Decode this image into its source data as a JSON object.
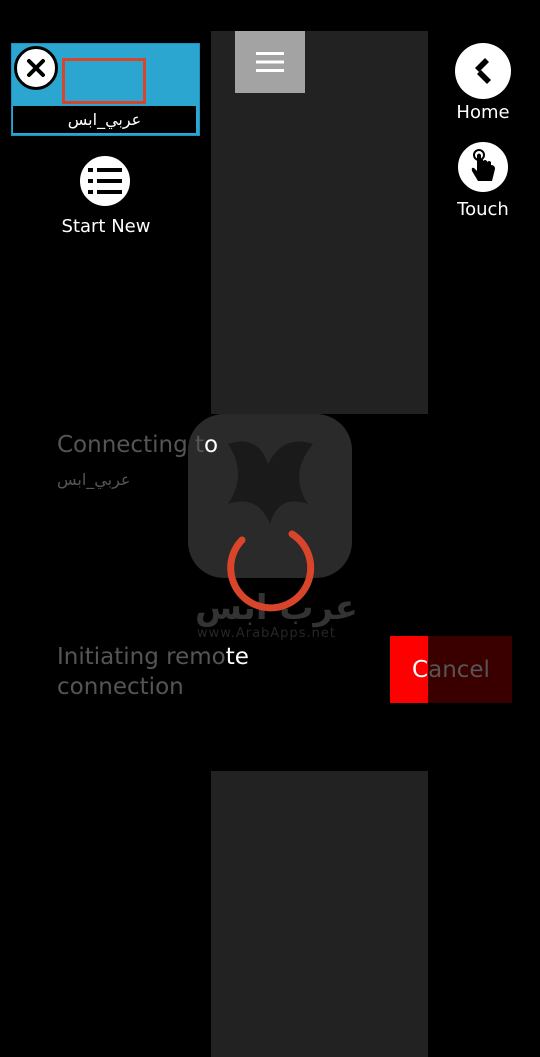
{
  "session": {
    "name": "عربي_ابس"
  },
  "toolbar": {
    "start_new_label": "Start New",
    "home_label": "Home",
    "touch_label": "Touch"
  },
  "dialog": {
    "connecting_prefix": "Connecting t",
    "connecting_suffix": "o",
    "target": "عربي_ابس",
    "status_line1_prefix": "Initiating remo",
    "status_line1_suffix": "te",
    "status_line2": "connection",
    "cancel_first": "C",
    "cancel_rest": "ancel"
  },
  "watermark": {
    "brand": "عرب ابس",
    "url": "www.ArabApps.net"
  },
  "colors": {
    "accent": "#d9452a",
    "thumb": "#2ba6d1",
    "cancel": "#ff0000"
  }
}
